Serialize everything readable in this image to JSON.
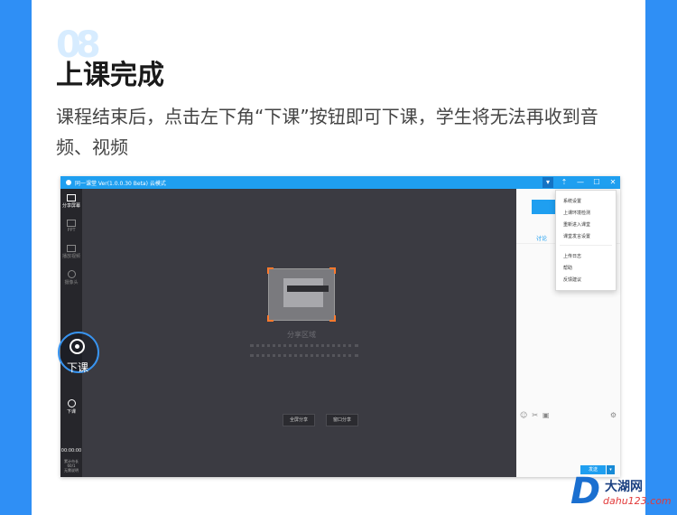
{
  "section": {
    "step_number": "08",
    "heading": "上课完成",
    "description": "课程结束后，点击左下角“下课”按钮即可下课，学生将无法再收到音频、视频"
  },
  "app": {
    "title": "同一课堂 Ver(1.0.0.30 Beta)  云模式",
    "window_controls": [
      "▾",
      "⇡",
      "—",
      "☐",
      "✕"
    ],
    "left_tools": [
      {
        "label": "分享屏幕",
        "icon": "screen-share-icon"
      },
      {
        "label": "PPT",
        "icon": "ppt-icon"
      },
      {
        "label": "播放视频",
        "icon": "video-icon"
      },
      {
        "label": "摄像头",
        "icon": "camera-icon"
      },
      {
        "label": "下课",
        "icon": "end-class-icon"
      }
    ],
    "highlight_label": "下课",
    "timer": "00:00:00",
    "stats": [
      "累计市长",
      "60/1",
      "无需说明"
    ],
    "share_area": {
      "title": "分享区域",
      "buttons": [
        "全屏分享",
        "窗口分享"
      ]
    },
    "right_panel": {
      "tab": "讨论",
      "send_label": "发送",
      "send_arrow": "▾",
      "tools": [
        "☺",
        "✂",
        "▣"
      ],
      "settings_glyph": "⚙"
    },
    "dropdown_menu": [
      "系统设置",
      "上课环境检测",
      "重新进入课堂",
      "课堂发言设置",
      "上传日志",
      "帮助",
      "反馈建议"
    ]
  },
  "watermark": {
    "letter": "D",
    "name": "大湖网",
    "url": "dahu123.com"
  }
}
